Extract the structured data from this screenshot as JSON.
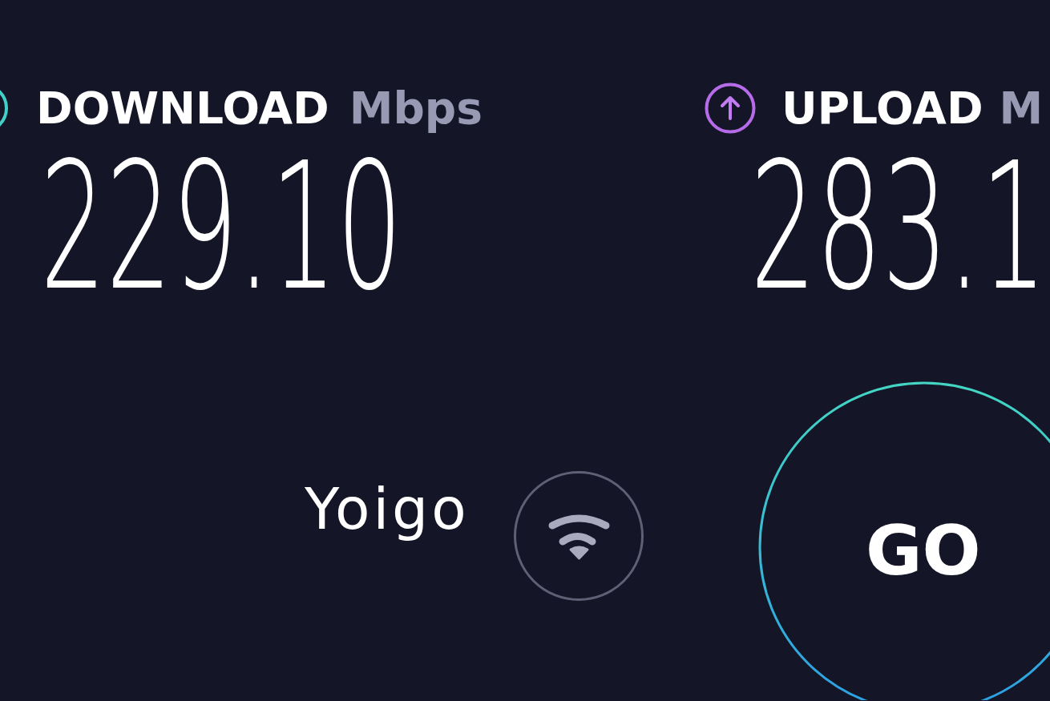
{
  "results": [
    {
      "kind": "download",
      "label": "DOWNLOAD",
      "unit": "Mbps",
      "value": "229.10"
    },
    {
      "kind": "upload",
      "label": "UPLOAD",
      "unit": "M",
      "value": "283.1"
    }
  ],
  "provider": {
    "name": "Yoigo"
  },
  "go_button": {
    "label": "GO"
  }
}
